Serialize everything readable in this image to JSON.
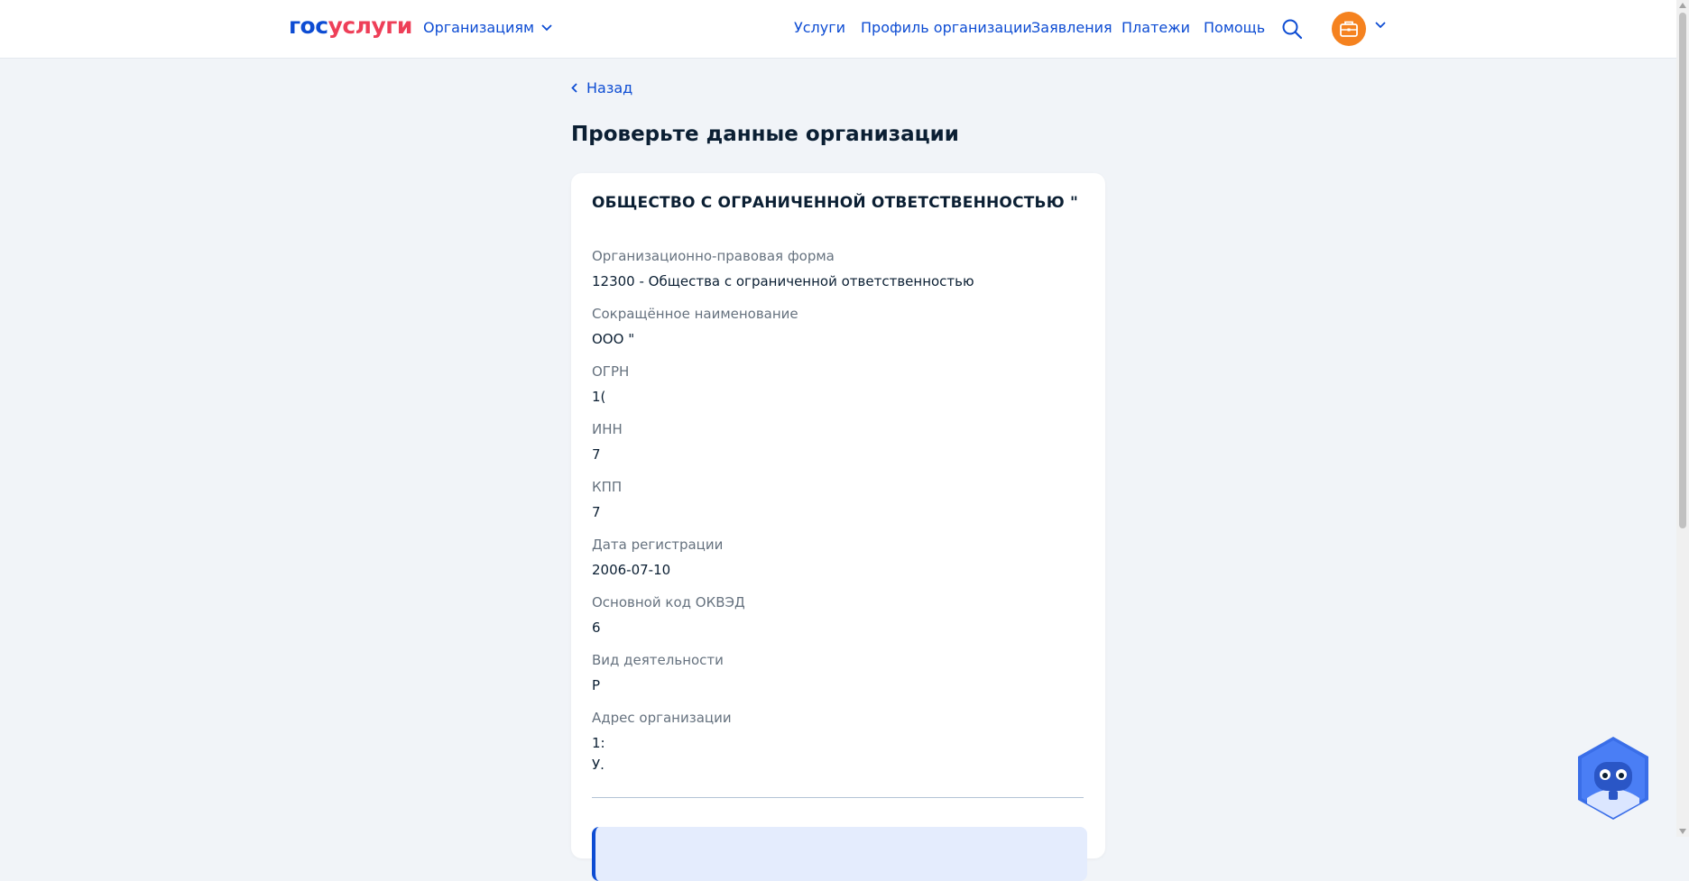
{
  "header": {
    "logo_part1": "гос",
    "logo_part2": "услуги",
    "org_menu_label": "Организациям",
    "nav": [
      {
        "label": "Услуги"
      },
      {
        "label": "Профиль организации"
      },
      {
        "label": "Заявления"
      },
      {
        "label": "Платежи"
      },
      {
        "label": "Помощь"
      }
    ],
    "icons": {
      "search": "search-icon",
      "avatar": "briefcase-icon",
      "menu": "chevron-down-icon"
    }
  },
  "page": {
    "back_label": "Назад",
    "title": "Проверьте данные организации"
  },
  "card": {
    "org_name": "ОБЩЕСТВО С ОГРАНИЧЕННОЙ ОТВЕТСТВЕННОСТЬЮ \"",
    "fields": [
      {
        "label": "Организационно-правовая форма",
        "value": "12300 - Общества с ограниченной ответственностью"
      },
      {
        "label": "Сокращённое наименование",
        "value": "ООО \""
      },
      {
        "label": "ОГРН",
        "value": "1("
      },
      {
        "label": "ИНН",
        "value": "7"
      },
      {
        "label": "КПП",
        "value": "7"
      },
      {
        "label": "Дата регистрации",
        "value": "2006-07-10"
      },
      {
        "label": "Основной код ОКВЭД",
        "value": "6"
      },
      {
        "label": "Вид деятельности",
        "value": "Р"
      },
      {
        "label": "Адрес организации",
        "value": "1:",
        "value2": "У."
      }
    ]
  },
  "colors": {
    "brand_blue": "#0d4cd3",
    "brand_red": "#ee3f58",
    "avatar_orange": "#f5821f",
    "page_bg": "#f1f4f8"
  }
}
